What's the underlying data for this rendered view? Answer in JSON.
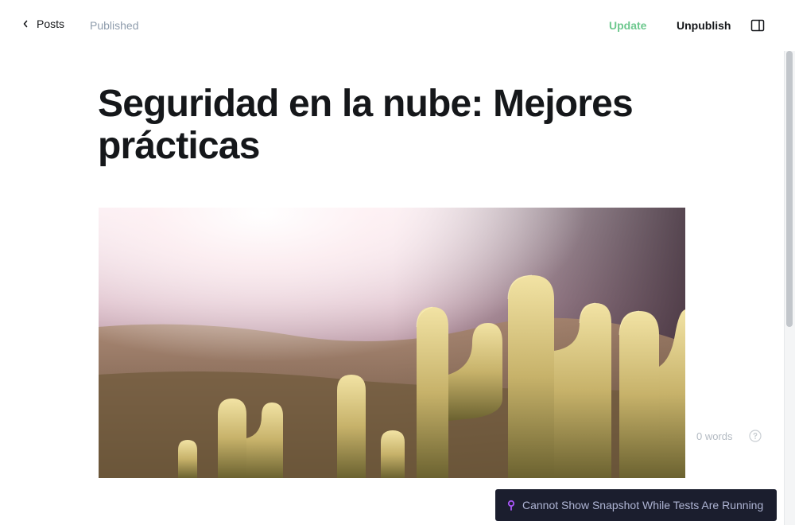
{
  "header": {
    "back_label": "Posts",
    "status": "Published",
    "update_label": "Update",
    "unpublish_label": "Unpublish"
  },
  "post": {
    "title": "Seguridad en la nube: Mejores prácticas"
  },
  "footer": {
    "word_count": "0 words"
  },
  "toast": {
    "message": "Cannot Show Snapshot While Tests Are Running"
  },
  "colors": {
    "update_green": "#6dc88e",
    "status_gray": "#8e9cac",
    "toast_bg": "#1b1e2e",
    "toast_icon": "#a855f7"
  },
  "icons": {
    "back": "chevron-left-icon",
    "sidebar": "sidebar-panel-icon",
    "help": "question-circle-icon",
    "toast": "pin-icon"
  }
}
